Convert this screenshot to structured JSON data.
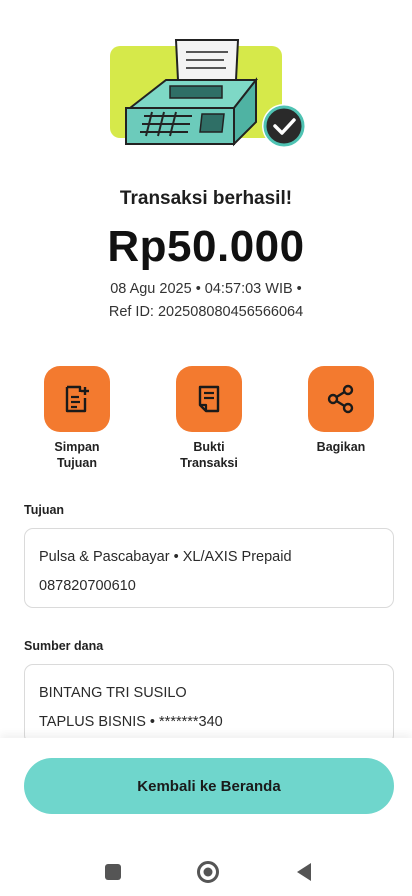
{
  "status": {
    "title": "Transaksi berhasil!",
    "amount": "Rp50.000",
    "datetime": "08 Agu 2025 • 04:57:03 WIB •",
    "ref": "Ref ID: 20250808045656606​4"
  },
  "actions": [
    {
      "label_line1": "Simpan",
      "label_line2": "Tujuan",
      "icon": "document-add-icon"
    },
    {
      "label_line1": "Bukti",
      "label_line2": "Transaksi",
      "icon": "receipt-icon"
    },
    {
      "label_line1": "Bagikan",
      "label_line2": "",
      "icon": "share-icon"
    }
  ],
  "tujuan": {
    "label": "Tujuan",
    "line1": "Pulsa & Pascabayar • XL/AXIS Prepaid",
    "line2": "087820700610"
  },
  "sumber": {
    "label": "Sumber dana",
    "line1": "BINTANG TRI SUSILO",
    "line2": "TAPLUS BISNIS • *******340"
  },
  "footer": {
    "home_button": "Kembali ke Beranda"
  },
  "colors": {
    "accent_orange": "#f37a2f",
    "accent_teal": "#6fd6cc",
    "illustration_lime": "#d6e94a"
  }
}
